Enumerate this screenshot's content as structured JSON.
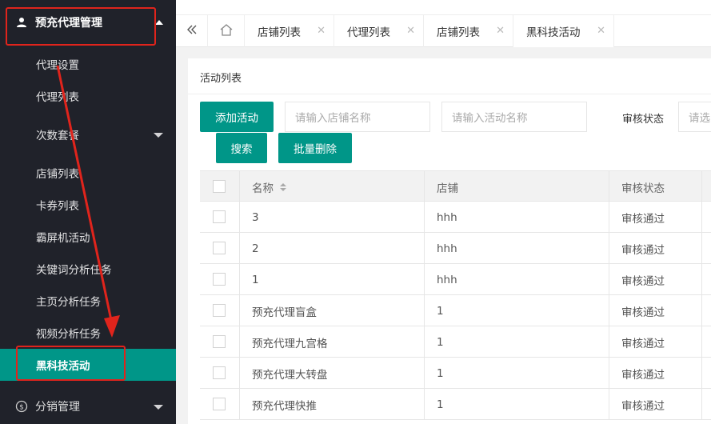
{
  "sidebar": {
    "top_group": {
      "label": "预充代理管理",
      "icon": "user-icon"
    },
    "items": [
      {
        "label": "代理设置"
      },
      {
        "label": "代理列表"
      },
      {
        "label": "次数套餐"
      },
      {
        "label": "店铺列表"
      },
      {
        "label": "卡券列表"
      },
      {
        "label": "霸屏机活动"
      },
      {
        "label": "关键词分析任务"
      },
      {
        "label": "主页分析任务"
      },
      {
        "label": "视频分析任务"
      },
      {
        "label": "黑科技活动"
      }
    ],
    "bottom_group": {
      "label": "分销管理",
      "icon": "dollar-icon"
    }
  },
  "tabs": [
    {
      "label": "店铺列表"
    },
    {
      "label": "代理列表"
    },
    {
      "label": "店铺列表"
    },
    {
      "label": "黑科技活动"
    }
  ],
  "panel": {
    "title": "活动列表"
  },
  "toolbar": {
    "add_label": "添加活动",
    "shop_placeholder": "请输入店铺名称",
    "activity_placeholder": "请输入活动名称",
    "status_label": "审核状态",
    "status_placeholder": "请选",
    "search_label": "搜索",
    "batch_delete_label": "批量删除"
  },
  "table": {
    "headers": [
      "名称",
      "店铺",
      "审核状态"
    ],
    "rows": [
      {
        "name": "3",
        "shop": "hhh",
        "status": "审核通过"
      },
      {
        "name": "2",
        "shop": "hhh",
        "status": "审核通过"
      },
      {
        "name": "1",
        "shop": "hhh",
        "status": "审核通过"
      },
      {
        "name": "预充代理盲盒",
        "shop": "1",
        "status": "审核通过"
      },
      {
        "name": "预充代理九宫格",
        "shop": "1",
        "status": "审核通过"
      },
      {
        "name": "预充代理大转盘",
        "shop": "1",
        "status": "审核通过"
      },
      {
        "name": "预充代理快推",
        "shop": "1",
        "status": "审核通过"
      }
    ]
  },
  "colors": {
    "accent": "#009688",
    "sidebar_bg": "#20222a",
    "annotation": "#e0241c"
  }
}
